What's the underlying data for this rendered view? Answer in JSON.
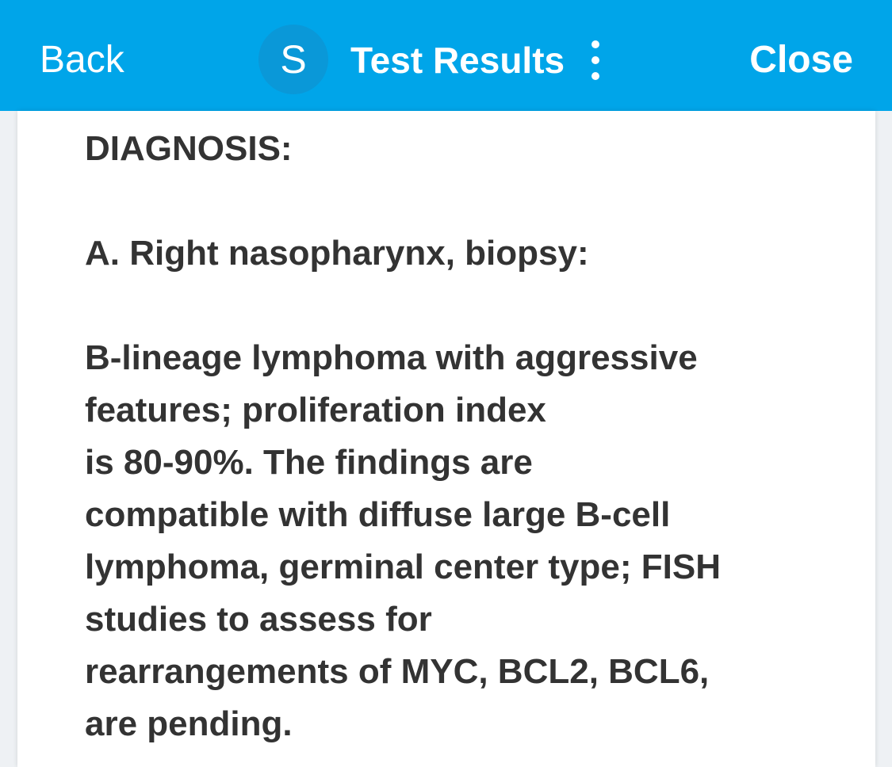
{
  "nav": {
    "back_label": "Back",
    "avatar_letter": "S",
    "title": "Test Results",
    "more_icon": "vertical-ellipsis",
    "close_label": "Close",
    "bar_color": "#00a5e9"
  },
  "report": {
    "text": "DIAGNOSIS:\n\nA. Right nasopharynx, biopsy:\n\nB-lineage lymphoma with aggressive\nfeatures; proliferation index\nis 80-90%. The findings are\ncompatible with diffuse large B-cell\nlymphoma, germinal center type; FISH\nstudies to assess for\nrearrangements of MYC, BCL2, BCL6,\nare pending."
  }
}
